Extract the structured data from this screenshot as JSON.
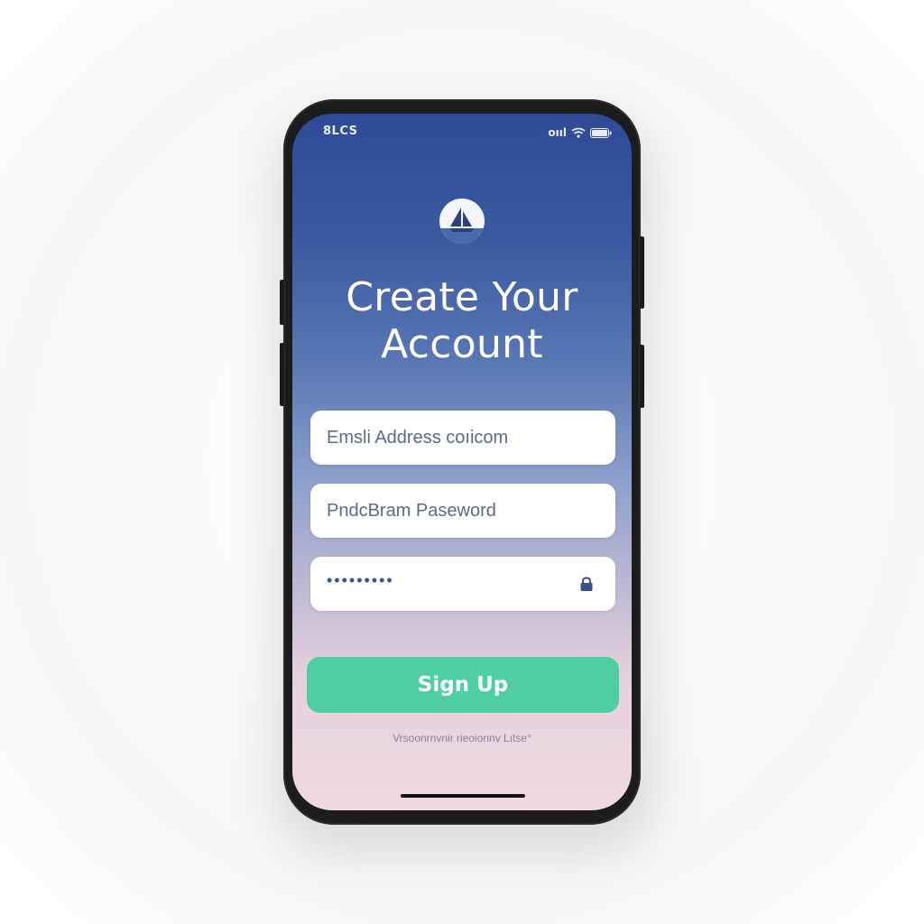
{
  "status_bar": {
    "time": "8LCS",
    "network": "ᴏııl"
  },
  "logo": {
    "icon": "sailboat-icon"
  },
  "page": {
    "title_line1": "Create Your",
    "title_line2": "Account"
  },
  "form": {
    "email_placeholder": "Emsli Address coıicom",
    "password_placeholder": "PndcBram Paseword",
    "confirm_value": "•••••••••",
    "confirm_icon": "lock-icon",
    "submit_label": "Sign Up"
  },
  "footer": {
    "link_text": "Vrsoonrnvnir rieoionnv Lıtse°"
  },
  "colors": {
    "gradient_top": "#2f4a96",
    "gradient_bottom": "#f1dbe1",
    "button": "#4fcfa1",
    "phone_frame": "#1c1c1e"
  }
}
